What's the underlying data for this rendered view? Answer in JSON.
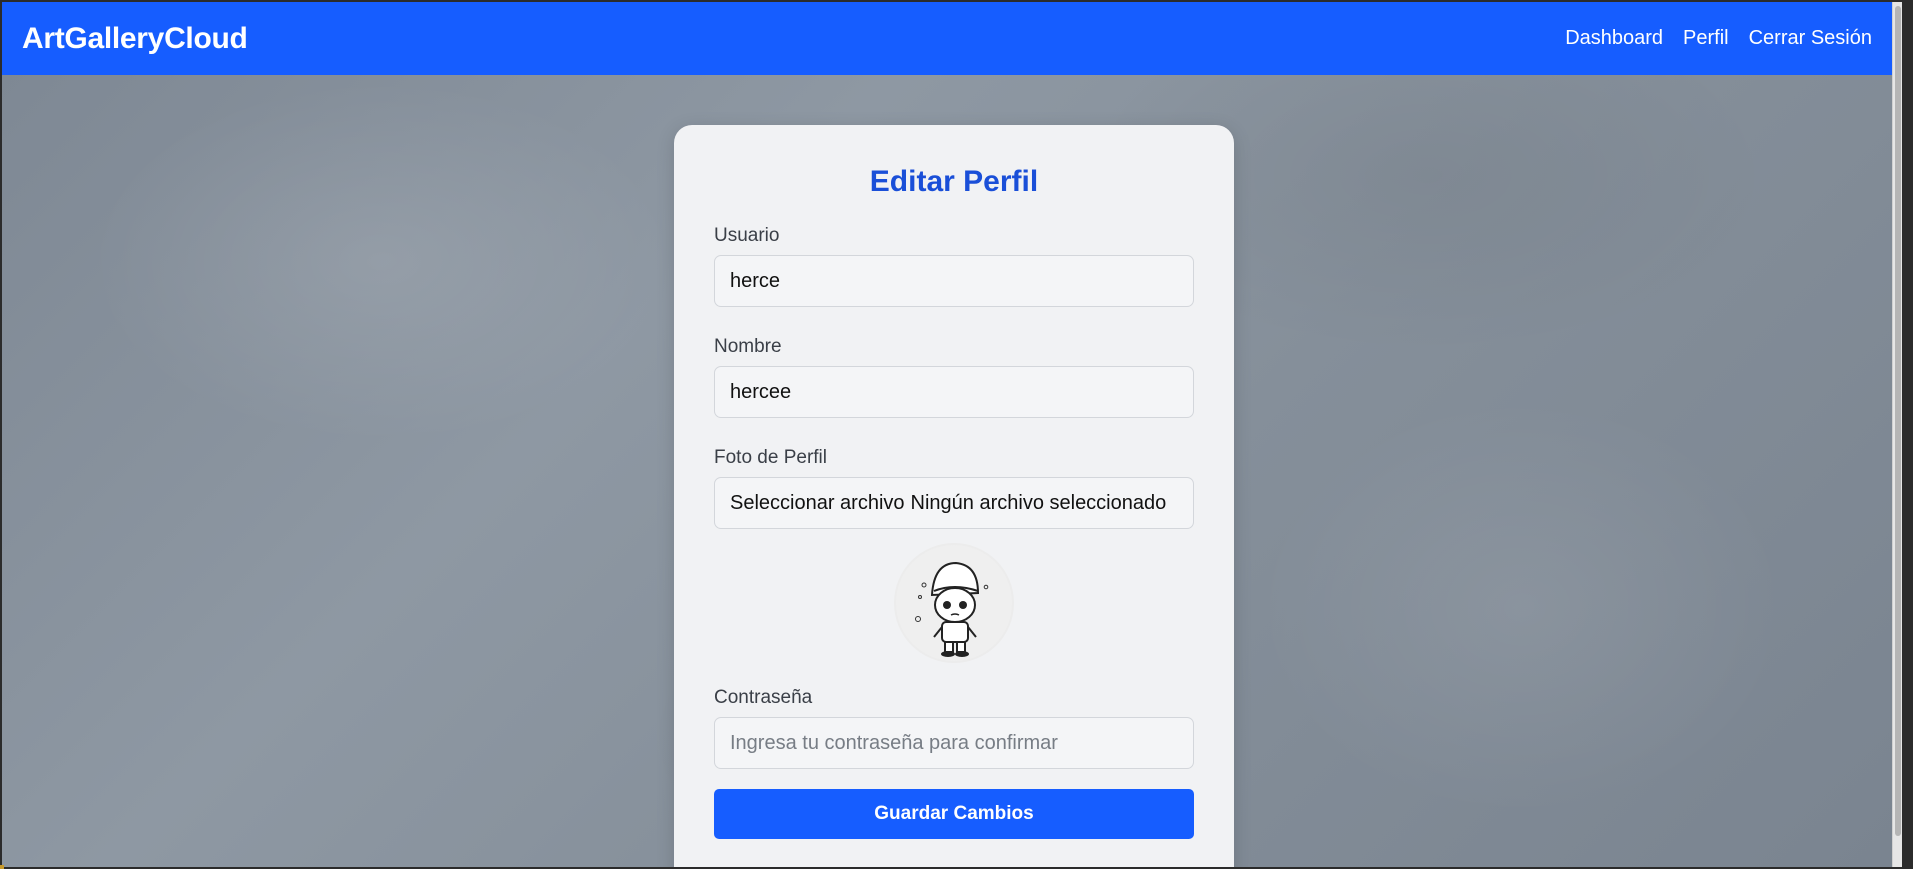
{
  "navbar": {
    "brand": "ArtGalleryCloud",
    "links": [
      {
        "label": "Dashboard"
      },
      {
        "label": "Perfil"
      },
      {
        "label": "Cerrar Sesión"
      }
    ],
    "color": "#165dff"
  },
  "form": {
    "title": "Editar Perfil",
    "username": {
      "label": "Usuario",
      "value": "herce"
    },
    "name": {
      "label": "Nombre",
      "value": "hercee"
    },
    "photo": {
      "label": "Foto de Perfil",
      "button_label": "Seleccionar archivo",
      "status": "Ningún archivo seleccionado"
    },
    "avatar": {
      "icon": "cartoon-avatar-icon"
    },
    "password": {
      "label": "Contraseña",
      "value": "",
      "placeholder": "Ingresa tu contraseña para confirmar"
    },
    "submit_label": "Guardar Cambios"
  },
  "colors": {
    "accent": "#165dff",
    "title": "#1a4fd8",
    "card_bg": "#f1f2f4"
  }
}
